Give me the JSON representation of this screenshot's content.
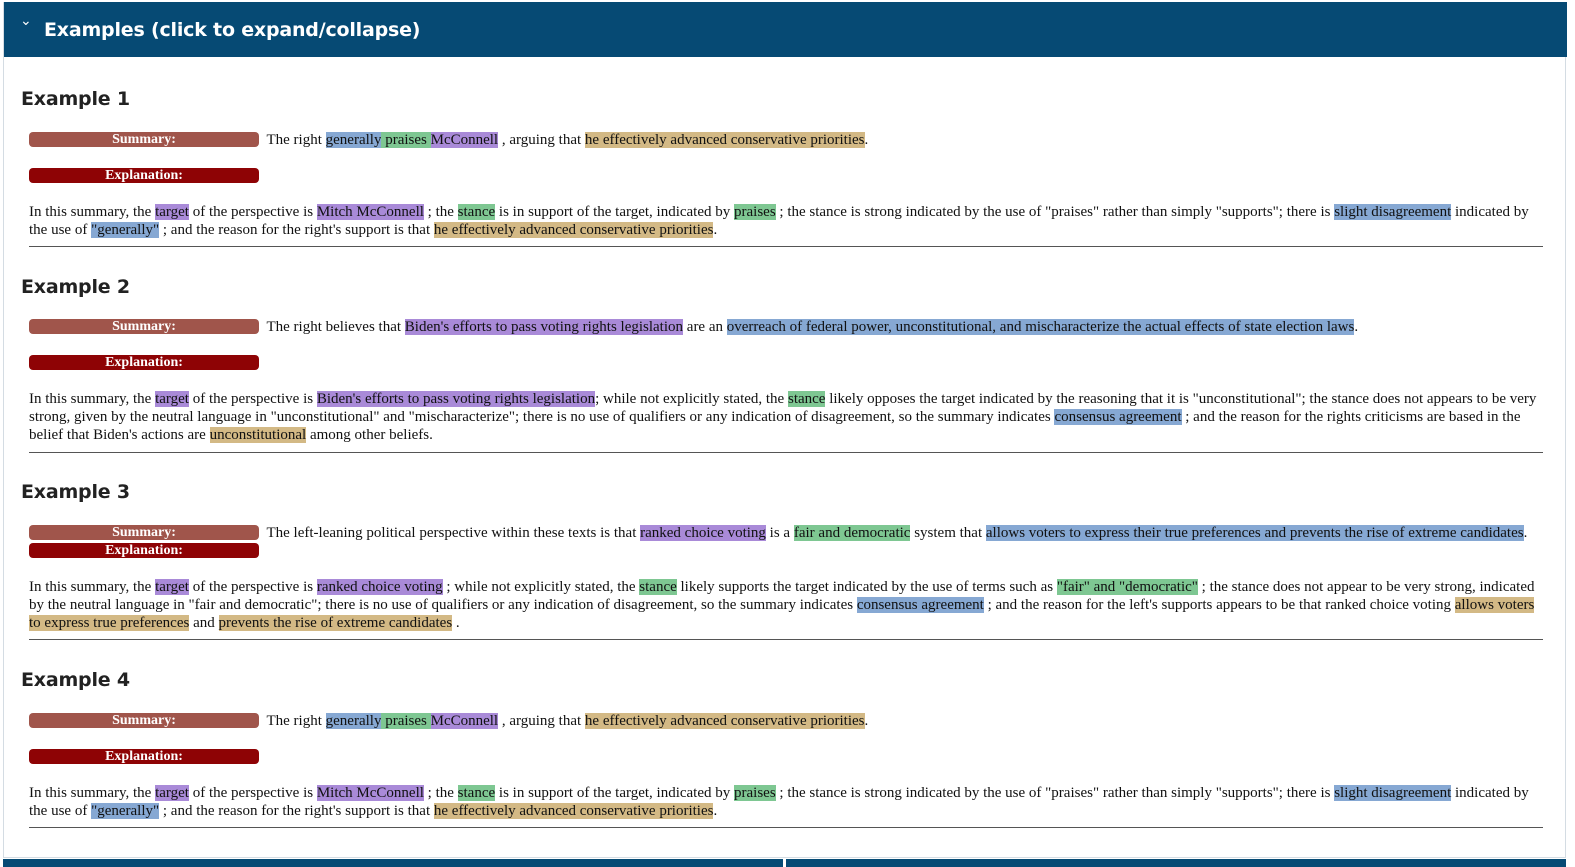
{
  "header": {
    "chevron": "⌄",
    "title": "Examples (click to expand/collapse)"
  },
  "badges": {
    "summary": "Summary:",
    "explanation": "Explanation:"
  },
  "colors": {
    "header_bg": "#064a74",
    "summary_badge": "#a0554b",
    "explanation_badge": "#8e0305",
    "target_highlight": "#a98ad8",
    "disagreement_highlight": "#86a8d3",
    "stance_highlight": "#7ec792",
    "reason_highlight": "#d3b985"
  },
  "examples": [
    {
      "title": "Example 1",
      "summary": {
        "t0": " The right ",
        "h1": "generally",
        "h2": " praises ",
        "h3": "McConnell",
        "t1": " , arguing that ",
        "h4": "he effectively advanced conservative priorities",
        "t2": "."
      },
      "explanation": {
        "t0": "In this summary, the ",
        "h1": "target",
        "t1": " of the perspective is ",
        "h2": "Mitch McConnell",
        "t2": " ; the ",
        "h3": "stance",
        "t3": " is in support of the target, indicated by ",
        "h4": "praises",
        "t4": " ; the stance is strong indicated by the use of \"praises\" rather than simply \"supports\"; there is ",
        "h5": "slight disagreement",
        "t5": " indicated by the use of ",
        "h6": "\"generally\"",
        "t6": " ; and the reason for the right's support is that ",
        "h7": "he effectively advanced conservative priorities",
        "t7": "."
      }
    },
    {
      "title": "Example 2",
      "summary": {
        "t0": " The right believes that ",
        "h1": "Biden's efforts to pass voting rights legislation",
        "t1": " are an ",
        "h2": "overreach of federal power, unconstitutional, and mischaracterize the actual effects of state election laws",
        "t2": "."
      },
      "explanation": {
        "t0": "In this summary, the ",
        "h1": "target",
        "t1": " of the perspective is ",
        "h2": "Biden's efforts to pass voting rights legislation",
        "t2": "; while not explicitly stated, the ",
        "h3": "stance",
        "t3": " likely opposes the target indicated by the reasoning that it is \"unconstitutional\"; the stance does not appears to be very strong, given by the neutral language in \"unconstitutional\" and \"mischaracterize\"; there is no use of qualifiers or any indication of disagreement, so the summary indicates ",
        "h4": "consensus agreement",
        "t4": " ; and the reason for the rights criticisms are based in the belief that Biden's actions are ",
        "h5": "unconstitutional",
        "t5": " among other beliefs."
      }
    },
    {
      "title": "Example 3",
      "summary": {
        "t0": " The left-leaning political perspective within these texts is that ",
        "h1": "ranked choice voting",
        "t1": " is a ",
        "h2": "fair and democratic",
        "t2": " system that ",
        "h3": "allows voters to express their true preferences and prevents the rise of extreme candidates",
        "t3": ". "
      },
      "explanation": {
        "t0": "In this summary, the ",
        "h1": "target",
        "t1": " of the perspective is ",
        "h2": "ranked choice voting",
        "t2": " ; while not explicitly stated, the ",
        "h3": "stance",
        "t3": " likely supports the target indicated by the use of terms such as ",
        "h4": "\"fair\" and \"democratic\"",
        "t4": " ; the stance does not appear to be very strong, indicated by the neutral language in \"fair and democratic\"; there is no use of qualifiers or any indication of disagreement, so the summary indicates ",
        "h5": "consensus agreement",
        "t5": " ; and the reason for the left's supports appears to be that ranked choice voting ",
        "h6": "allows voters to express true preferences",
        "t6": " and ",
        "h7": "prevents the rise of extreme candidates",
        "t7": " ."
      }
    },
    {
      "title": "Example 4",
      "summary": {
        "t0": " The right ",
        "h1": "generally",
        "h2": " praises ",
        "h3": "McConnell",
        "t1": " , arguing that ",
        "h4": "he effectively advanced conservative priorities",
        "t2": "."
      },
      "explanation": {
        "t0": "In this summary, the ",
        "h1": "target",
        "t1": " of the perspective is ",
        "h2": "Mitch McConnell",
        "t2": " ; the ",
        "h3": "stance",
        "t3": " is in support of the target, indicated by ",
        "h4": "praises",
        "t4": " ; the stance is strong indicated by the use of \"praises\" rather than simply \"supports\"; there is ",
        "h5": "slight disagreement",
        "t5": " indicated by the use of ",
        "h6": "\"generally\"",
        "t6": " ; and the reason for the right's support is that ",
        "h7": "he effectively advanced conservative priorities",
        "t7": "."
      }
    }
  ]
}
